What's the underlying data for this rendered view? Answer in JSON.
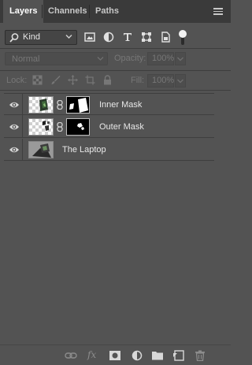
{
  "tabs": [
    {
      "label": "Layers",
      "active": true
    },
    {
      "label": "Channels",
      "active": false
    },
    {
      "label": "Paths",
      "active": false
    }
  ],
  "filter": {
    "kind_label": "Kind",
    "icons": [
      "pixel-layer-filter-icon",
      "adjustment-layer-filter-icon",
      "type-layer-filter-icon",
      "shape-layer-filter-icon",
      "smart-object-filter-icon"
    ]
  },
  "blend": {
    "mode": "Normal",
    "opacity_label": "Opacity:",
    "opacity_value": "100%"
  },
  "lock": {
    "label": "Lock:",
    "fill_label": "Fill:",
    "fill_value": "100%"
  },
  "layers": [
    {
      "name": "Inner Mask",
      "visible": true,
      "has_mask": true
    },
    {
      "name": "Outer Mask",
      "visible": true,
      "has_mask": true
    },
    {
      "name": "The Laptop",
      "visible": true,
      "has_mask": false
    }
  ],
  "bottom_icons": [
    "link-layers-icon",
    "fx-icon",
    "add-mask-icon",
    "adjustment-layer-icon",
    "new-group-icon",
    "new-layer-icon",
    "delete-layer-icon"
  ],
  "bottom": {
    "fx_text": "fx"
  },
  "colors": {
    "panel_bg": "#535353",
    "tabbar_bg": "#3a3a3a",
    "text": "#e8e8e8"
  }
}
